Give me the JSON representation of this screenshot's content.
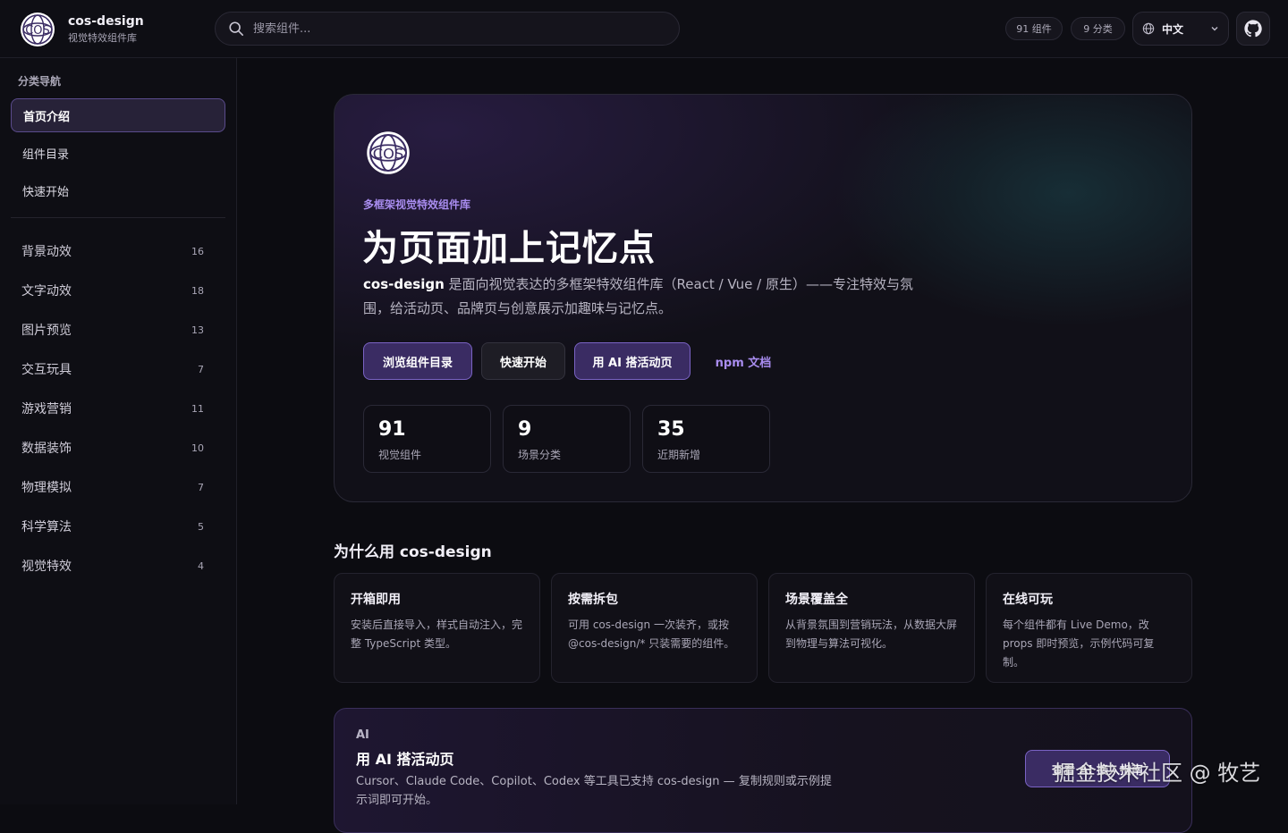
{
  "header": {
    "brand_name": "cos-design",
    "brand_subtitle": "视觉特效组件库",
    "search_placeholder": "搜索组件...",
    "component_count_badge": "91 组件",
    "category_count_badge": "9 分类",
    "language": "中文"
  },
  "sidebar": {
    "title": "分类导航",
    "nav": [
      {
        "label": "首页介绍",
        "active": true
      },
      {
        "label": "组件目录",
        "active": false
      },
      {
        "label": "快速开始",
        "active": false
      }
    ],
    "categories": [
      {
        "label": "背景动效",
        "count": "16"
      },
      {
        "label": "文字动效",
        "count": "18"
      },
      {
        "label": "图片预览",
        "count": "13"
      },
      {
        "label": "交互玩具",
        "count": "7"
      },
      {
        "label": "游戏营销",
        "count": "11"
      },
      {
        "label": "数据装饰",
        "count": "10"
      },
      {
        "label": "物理模拟",
        "count": "7"
      },
      {
        "label": "科学算法",
        "count": "5"
      },
      {
        "label": "视觉特效",
        "count": "4"
      }
    ]
  },
  "hero": {
    "eyebrow": "多框架视觉特效组件库",
    "title": "为页面加上记忆点",
    "desc_brand": "cos-design",
    "desc_text": " 是面向视觉表达的多框架特效组件库（React / Vue / 原生）——专注特效与氛围，给活动页、品牌页与创意展示加趣味与记忆点。",
    "buttons": {
      "browse": "浏览组件目录",
      "quickstart": "快速开始",
      "ai": "用 AI 搭活动页",
      "npm": "npm 文档"
    },
    "stats": [
      {
        "value": "91",
        "label": "视觉组件"
      },
      {
        "value": "9",
        "label": "场景分类"
      },
      {
        "value": "35",
        "label": "近期新增"
      }
    ]
  },
  "why": {
    "title": "为什么用 cos-design",
    "features": [
      {
        "title": "开箱即用",
        "desc": "安装后直接导入，样式自动注入，完整 TypeScript 类型。"
      },
      {
        "title": "按需拆包",
        "desc": "可用 cos-design 一次装齐，或按 @cos-design/* 只装需要的组件。"
      },
      {
        "title": "场景覆盖全",
        "desc": "从背景氛围到营销玩法，从数据大屏到物理与算法可视化。"
      },
      {
        "title": "在线可玩",
        "desc": "每个组件都有 Live Demo，改 props 即时预览，示例代码可复制。"
      }
    ]
  },
  "ai_card": {
    "tag": "AI",
    "title": "用 AI 搭活动页",
    "desc": "Cursor、Claude Code、Copilot、Codex 等工具已支持 cos-design — 复制规则或示例提示词即可开始。",
    "button": "查看 AI 接入指南"
  },
  "watermark": "掘金技术社区 @ 牧艺",
  "colors": {
    "background": "#0c0c11",
    "accent": "#a98df0",
    "primary_button": "#3a2c63"
  }
}
